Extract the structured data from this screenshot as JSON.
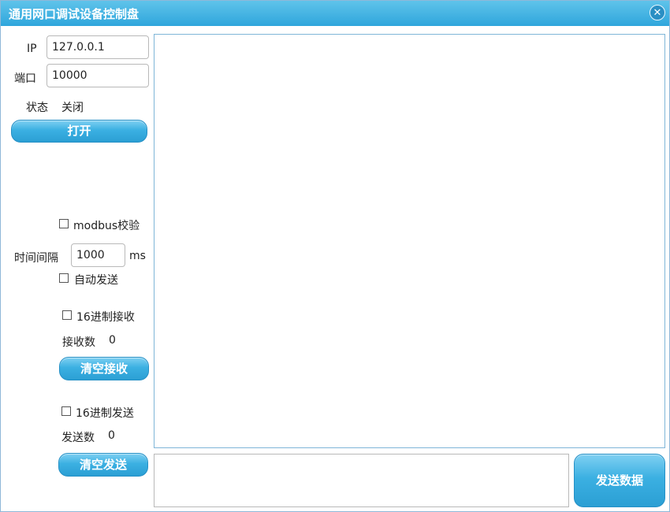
{
  "window": {
    "title": "通用网口调试设备控制盘"
  },
  "connection": {
    "ip_label": "IP",
    "ip_value": "127.0.0.1",
    "port_label": "端口",
    "port_value": "10000",
    "status_label": "状态",
    "status_value": "关闭",
    "open_button": "打开"
  },
  "options": {
    "modbus_label": "modbus校验",
    "interval_label": "时间间隔",
    "interval_value": "1000",
    "interval_unit": "ms",
    "auto_send_label": "自动发送"
  },
  "receive": {
    "hex_label": "16进制接收",
    "count_label": "接收数",
    "count_value": "0",
    "clear_button": "清空接收"
  },
  "send": {
    "hex_label": "16进制发送",
    "count_label": "发送数",
    "count_value": "0",
    "clear_button": "清空发送",
    "send_button": "发送数据",
    "input_value": ""
  },
  "receive_area": {
    "content": ""
  }
}
